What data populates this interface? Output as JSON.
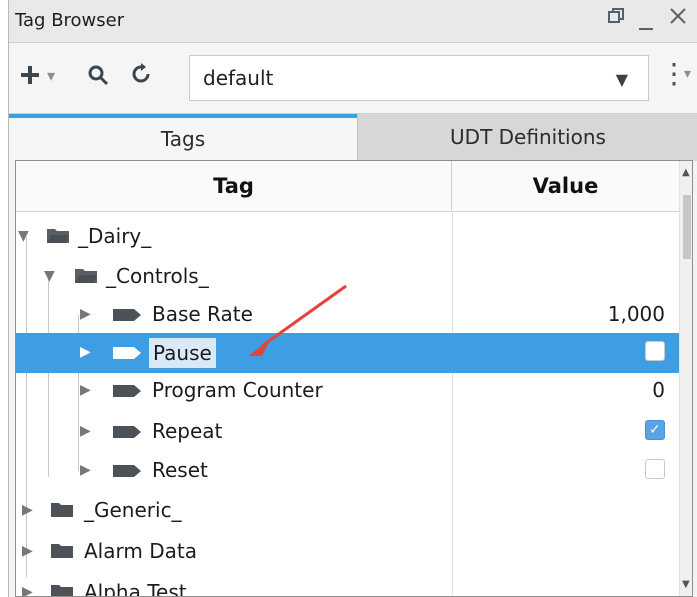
{
  "window": {
    "title": "Tag Browser",
    "controls": [
      "restore-icon",
      "minimize-icon",
      "close-icon"
    ]
  },
  "toolbar": {
    "add_icon": "plus-icon",
    "search_icon": "search-icon",
    "refresh_icon": "refresh-icon",
    "provider_value": "default",
    "more_icon": "more-vertical-icon"
  },
  "tabs": [
    {
      "label": "Tags",
      "active": true
    },
    {
      "label": "UDT Definitions",
      "active": false
    }
  ],
  "table": {
    "columns": [
      "Tag",
      "Value"
    ],
    "rows": [
      {
        "name": "_Dairy_",
        "type": "folder",
        "expanded": true,
        "value": ""
      },
      {
        "name": "_Controls_",
        "type": "folder",
        "expanded": true,
        "value": ""
      },
      {
        "name": "Base Rate",
        "type": "tag",
        "value": "1,000"
      },
      {
        "name": "Pause",
        "type": "tag",
        "selected": true,
        "value": ""
      },
      {
        "name": "Program Counter",
        "type": "tag",
        "value": "0"
      },
      {
        "name": "Repeat",
        "type": "tag",
        "value": "",
        "checked": true
      },
      {
        "name": "Reset",
        "type": "tag",
        "value": ""
      },
      {
        "name": "_Generic_",
        "type": "folder",
        "value": ""
      },
      {
        "name": "Alarm Data",
        "type": "folder",
        "value": ""
      },
      {
        "name": "Alpha Test",
        "type": "folder",
        "value": ""
      }
    ]
  },
  "colors": {
    "selection": "#3d9ee4",
    "active_tab_border": "#3aa1df",
    "annotation_arrow": "#e2443b"
  }
}
